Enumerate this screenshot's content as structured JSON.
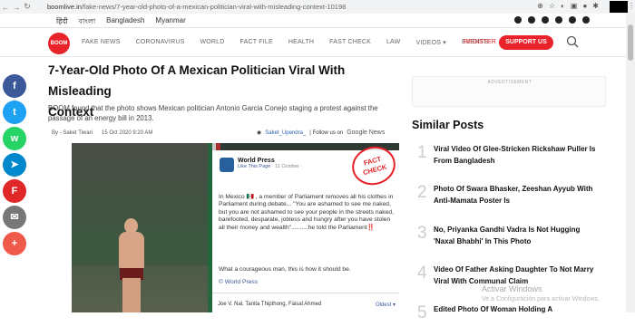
{
  "browser": {
    "url_domain": "boomlive.in",
    "url_path": "/fake-news/7-year-old-photo-of-a-mexican-politician-viral-with-misleading-context-10198"
  },
  "language_bar": {
    "languages": [
      "हिंदी",
      "বাংলা",
      "Bangladesh",
      "Myanmar"
    ]
  },
  "header": {
    "logo": "BOOM",
    "nav": [
      "FAKE NEWS",
      "CORONAVIRUS",
      "WORLD",
      "FACT FILE",
      "HEALTH",
      "FAST CHECK",
      "LAW",
      "VIDEOS ▾",
      "EVENTS"
    ],
    "register": "REGISTER",
    "support": "SUPPORT US"
  },
  "share_buttons": [
    {
      "icon": "facebook-icon",
      "color": "#3b5998",
      "glyph": "f"
    },
    {
      "icon": "twitter-icon",
      "color": "#1da1f2",
      "glyph": "t"
    },
    {
      "icon": "whatsapp-icon",
      "color": "#25d366",
      "glyph": "w"
    },
    {
      "icon": "telegram-icon",
      "color": "#0088cc",
      "glyph": "➤"
    },
    {
      "icon": "flipboard-icon",
      "color": "#e12828",
      "glyph": "F"
    },
    {
      "icon": "email-icon",
      "color": "#777777",
      "glyph": "✉"
    },
    {
      "icon": "more-icon",
      "color": "#f05a4a",
      "glyph": "+"
    }
  ],
  "article": {
    "title_line1": "7-Year-Old Photo Of A Mexican Politician Viral With Misleading",
    "title_line2": "Context",
    "summary": "BOOM found that the photo shows Mexican politician Antonio Garcia Conejo staging a protest against the passage of an energy bill in 2013.",
    "author": "By - Saket Tiwari",
    "date": "15 Oct 2020 9:20 AM",
    "twitter_handle": "Saket_Upendra_",
    "follow_text": "| Follow us on",
    "google_news": "Google News"
  },
  "embedded_post": {
    "page_name": "World Press",
    "like_page": "Like This Page",
    "date": "· 11 October ·",
    "text": "In Mexico 🇲🇽 , a member of Parliament removes all his clothes in Parliament during debate... \"You are ashamed to see me naked, but you are not ashamed to see your people in the streets naked, barefooted, desparate, jobless and hungry after you have stolen all their money and wealth\"..........he told the Parliament‼️",
    "text2": "What a courageous man, this is how it should be.",
    "link": "© World Press",
    "footer_names": "Joe V. Nal, Tanita Thipthong, Faisal Ahmed",
    "footer_sort": "Oldest ▾",
    "stamp_line1": "FACT",
    "stamp_line2": "CHECK"
  },
  "sidebar": {
    "ad_label": "ADVERTISEMENT",
    "heading": "Similar Posts",
    "posts": [
      {
        "num": "1",
        "title": "Viral Video Of Glee-Stricken Rickshaw Puller Is From Bangladesh"
      },
      {
        "num": "2",
        "title": "Photo Of Swara Bhasker, Zeeshan Ayyub With Anti-Mamata Poster Is"
      },
      {
        "num": "3",
        "title": "No, Priyanka Gandhi Vadra Is Not Hugging 'Naxal Bhabhi' In This Photo"
      },
      {
        "num": "4",
        "title": "Video Of Father Asking Daughter To Not Marry Viral With Communal Claim"
      },
      {
        "num": "5",
        "title": "Edited Photo Of Woman Holding A"
      }
    ]
  },
  "watermark": {
    "line1": "Activar Windows",
    "line2": "Ve a Configuración para activar Windows."
  }
}
